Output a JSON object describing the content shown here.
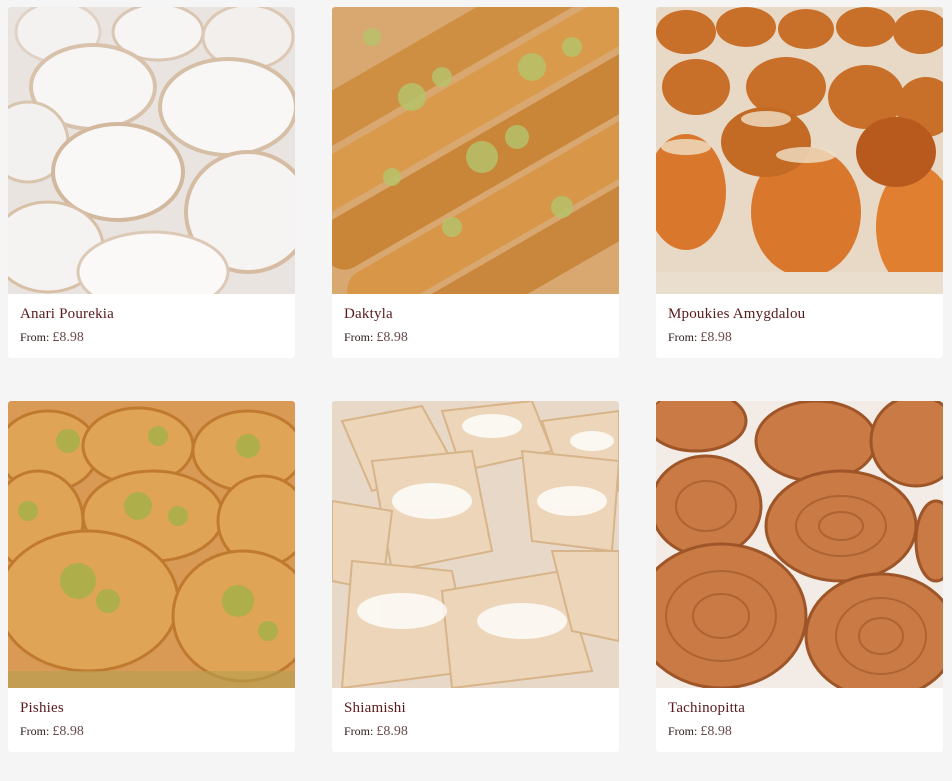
{
  "products": [
    {
      "name": "Anari Pourekia",
      "from_label": "From:",
      "price": "£8.98",
      "image": "powdered-pastries-photo",
      "tone": "white"
    },
    {
      "name": "Daktyla",
      "from_label": "From:",
      "price": "£8.98",
      "image": "pistachio-rolls-photo",
      "tone": "golden"
    },
    {
      "name": "Mpoukies Amygdalou",
      "from_label": "From:",
      "price": "£8.98",
      "image": "syrup-balls-photo",
      "tone": "orange"
    },
    {
      "name": "Pishies",
      "from_label": "From:",
      "price": "£8.98",
      "image": "pistachio-pastries-photo",
      "tone": "amber"
    },
    {
      "name": "Shiamishi",
      "from_label": "From:",
      "price": "£8.98",
      "image": "sugar-dusted-pastries-photo",
      "tone": "cream"
    },
    {
      "name": "Tachinopitta",
      "from_label": "From:",
      "price": "£8.98",
      "image": "spiral-buns-photo",
      "tone": "brown"
    }
  ],
  "colors": {
    "background": "#f5f5f5",
    "card": "#ffffff",
    "title": "#5a1a1a",
    "price": "#6a4a4a"
  }
}
